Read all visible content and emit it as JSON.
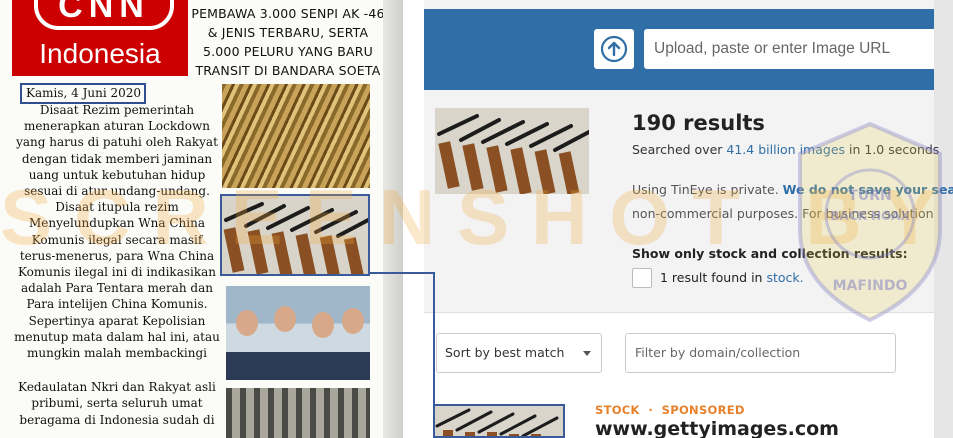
{
  "newspaper": {
    "brand_mark": "CNN",
    "brand_name": "Indonesia",
    "headline": "PEMBAWA 3.000 SENPI AK -46 & JENIS TERBARU, SERTA 5.000 PELURU YANG BARU TRANSIT DI BANDARA SOETA",
    "date": "Kamis, 4 Juni 2020",
    "paragraph_1": "Disaat Rezim pemerintah menerapkan aturan Lockdown yang harus di patuhi oleh Rakyat dengan tidak memberi jaminan uang untuk kebutuhan hidup sesuai di atur undang-undang. Disaat itupula rezim Menyelundupkan Wna China Komunis ilegal secara masif terus-menerus, para Wna China Komunis ilegal ini di indikasikan adalah Para Tentara merah dan Para intelijen China Komunis. Sepertinya aparat Kepolisian menutup mata dalam hal ini, atau mungkin malah membackingi",
    "paragraph_2": "Kedaulatan Nkri dan Rakyat asli pribumi, serta seluruh umat beragama di Indonesia sudah di"
  },
  "tineye": {
    "search": {
      "upload_icon": "upload-arrow-icon",
      "placeholder": "Upload, paste or enter Image URL"
    },
    "results": {
      "count_text": "190 results",
      "searched_prefix": "Searched over ",
      "searched_link": "41.4 billion images",
      "searched_suffix": " in 1.0 seconds",
      "privacy_prefix": "Using TinEye is private. ",
      "privacy_link": "We do not save your sea",
      "noncommercial": "non-commercial purposes. For business solution",
      "stock_heading": "Show only stock and collection results:",
      "stock_count": "1 result found in ",
      "stock_link": "stock."
    },
    "controls": {
      "sort_label": "Sort by best match",
      "filter_placeholder": "Filter by domain/collection"
    },
    "first_result": {
      "tag_stock": "STOCK",
      "tag_separator": "·",
      "tag_sponsored": "SPONSORED",
      "domain": "www.gettyimages.com"
    }
  },
  "watermark": {
    "text": "SCREENSHOT BY",
    "seal_top": "TURN",
    "seal_middle": "BACK HOAX",
    "seal_bottom": "MAFINDO"
  },
  "colors": {
    "tineye_blue": "#2f6ea6",
    "link_blue": "#2f6ea6",
    "sponsored_orange": "#e8812b",
    "highlight_box": "#3a5a9a",
    "cnn_red": "#cc0000"
  }
}
